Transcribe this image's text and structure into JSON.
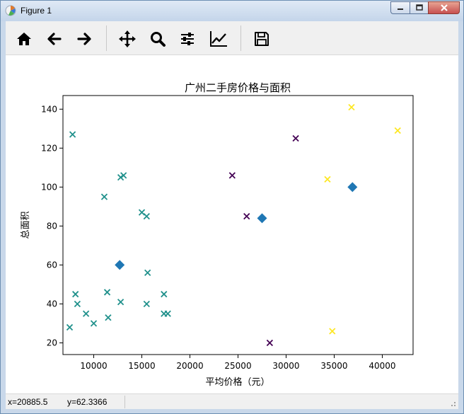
{
  "window": {
    "title": "Figure 1",
    "controls": [
      "minimize",
      "maximize",
      "close"
    ]
  },
  "toolbar": {
    "buttons": [
      {
        "name": "home",
        "icon": "home-icon"
      },
      {
        "name": "back",
        "icon": "arrow-left-icon"
      },
      {
        "name": "forward",
        "icon": "arrow-right-icon"
      },
      {
        "name": "pan",
        "icon": "move-icon"
      },
      {
        "name": "zoom",
        "icon": "search-icon"
      },
      {
        "name": "subplots",
        "icon": "sliders-icon"
      },
      {
        "name": "edit-axis",
        "icon": "line-chart-icon"
      },
      {
        "name": "save",
        "icon": "save-icon"
      }
    ]
  },
  "status": {
    "x": "x=20885.5",
    "y": "y=62.3366"
  },
  "chart_data": {
    "type": "scatter",
    "title": "广州二手房价格与面积",
    "xlabel": "平均价格（元）",
    "ylabel": "总面积",
    "xlim": [
      6800,
      43200
    ],
    "ylim": [
      14,
      147
    ],
    "xticks": [
      10000,
      15000,
      20000,
      25000,
      30000,
      35000,
      40000
    ],
    "xtick_labels": [
      "10000",
      "15000",
      "20000",
      "25000",
      "30000",
      "35000",
      "40000"
    ],
    "yticks": [
      20,
      40,
      60,
      80,
      100,
      120,
      140
    ],
    "ytick_labels": [
      "20",
      "40",
      "60",
      "80",
      "100",
      "120",
      "140"
    ],
    "grid": false,
    "colors": {
      "cluster_a": "#440154",
      "cluster_b": "#21918c",
      "cluster_c": "#fde725",
      "centers": "#1f77b4"
    },
    "series": [
      {
        "marker": "x",
        "color": "#440154",
        "points": [
          [
            24400,
            106
          ],
          [
            25900,
            85
          ],
          [
            31000,
            125
          ],
          [
            28300,
            20
          ]
        ]
      },
      {
        "marker": "x",
        "color": "#21918c",
        "points": [
          [
            7800,
            127
          ],
          [
            12800,
            105
          ],
          [
            13100,
            106
          ],
          [
            11100,
            95
          ],
          [
            15000,
            87
          ],
          [
            15500,
            85
          ],
          [
            15600,
            56
          ],
          [
            8100,
            45
          ],
          [
            8300,
            40
          ],
          [
            9200,
            35
          ],
          [
            10000,
            30
          ],
          [
            7500,
            28
          ],
          [
            11400,
            46
          ],
          [
            11500,
            33
          ],
          [
            12800,
            41
          ],
          [
            15500,
            40
          ],
          [
            17300,
            45
          ],
          [
            17300,
            35
          ],
          [
            17700,
            35
          ]
        ]
      },
      {
        "marker": "x",
        "color": "#fde725",
        "points": [
          [
            36800,
            141
          ],
          [
            41600,
            129
          ],
          [
            34300,
            104
          ],
          [
            34800,
            26
          ]
        ]
      },
      {
        "marker": "D",
        "color": "#1f77b4",
        "points": [
          [
            12700,
            60
          ],
          [
            27500,
            84
          ],
          [
            36900,
            100
          ]
        ]
      }
    ]
  }
}
